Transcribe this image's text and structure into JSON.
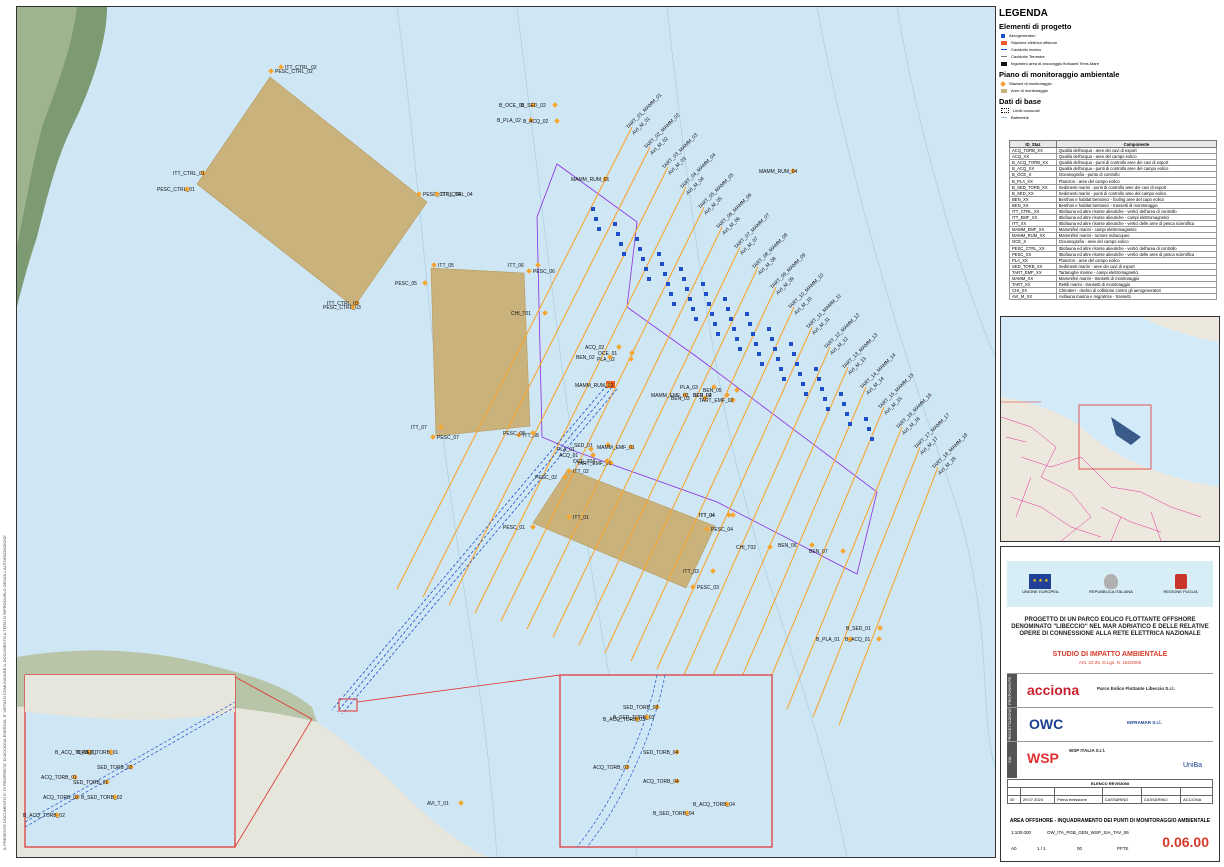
{
  "legend": {
    "title": "LEGENDA",
    "sections": [
      {
        "title": "Elementi di progetto",
        "items": [
          {
            "label": "Aerogeneratori",
            "color": "#1f4fc8",
            "kind": "square"
          },
          {
            "label": "Stazione elettrica offshore",
            "color": "#f15a22",
            "kind": "rect"
          },
          {
            "label": "Cavidotto marino",
            "color": "#1f4fc8",
            "kind": "dash"
          },
          {
            "label": "Cavidotto Terrestre",
            "color": "#7a7a7a",
            "kind": "dash"
          },
          {
            "label": "Ingombro area di ancoraggio fluttuanti Terra-Mare",
            "color": "#111111",
            "kind": "rect"
          }
        ]
      },
      {
        "title": "Piano di monitoraggio ambientale",
        "items": [
          {
            "label": "Stazioni di monitoraggio",
            "color": "#f0a030",
            "kind": "diamond"
          },
          {
            "label": "Aree di monitoraggio",
            "color": "#c9b27c",
            "kind": "rect"
          }
        ]
      },
      {
        "title": "Dati di base",
        "items": [
          {
            "label": "Limiti comunali",
            "color": "#111111",
            "kind": "dots"
          },
          {
            "label": "Batimetrie",
            "color": "#9fc4dd",
            "kind": "line"
          }
        ]
      }
    ]
  },
  "component_table": {
    "headers": [
      "ID_Staz",
      "Componente"
    ],
    "rows": [
      [
        "ACQ_TORB_XX",
        "Qualità dell'acqua - aree dei cavi di export"
      ],
      [
        "ACQ_XX",
        "Qualità dell'acqua - aree del campo eolico"
      ],
      [
        "B_ACQ_TORB_XX",
        "Qualità dell'acqua - punti di controllo aree dei cavi di export"
      ],
      [
        "B_ACQ_XX",
        "Qualità dell'acqua - punti di controllo aree del campo eolico"
      ],
      [
        "B_OCE_X",
        "Oceanografia - punto di controllo"
      ],
      [
        "B_PLA_XX",
        "Plancton - aree del campo eolico"
      ],
      [
        "B_SED_TORB_XX",
        "Sedimenti marini - punti di controllo aree dei cavi di export"
      ],
      [
        "B_SED_XX",
        "Sedimenti marini - punti di controllo aree del campo eolico"
      ],
      [
        "BEN_XX",
        "Benthos e habitat bentonici - fouling aree del capo eolico"
      ],
      [
        "BEN_XX",
        "Benthos e habitat bentonici - transetti di monitoraggio"
      ],
      [
        "ITT_CTRL_XX",
        "Ittiofauna ed altre risorse alieutiche - vertici dell'area di controllo"
      ],
      [
        "ITT_EMF_XX",
        "Ittiofauna ed altre risorse alieutiche - campi elettromagnetici"
      ],
      [
        "ITT_XX",
        "Ittiofauna ed altre risorse alieutiche - vertici delle aree di pesca scientifica"
      ],
      [
        "MAMM_EMF_XX",
        "Mammiferi marini - campi elettromagnetici"
      ],
      [
        "MAMM_RUM_XX",
        "Mammiferi marini - rumore subacqueo"
      ],
      [
        "OCE_X",
        "Oceanografia - aree del campo eolico"
      ],
      [
        "PESC_CTRL_XX",
        "Ittiofauna ed altre risorse alieutiche - vertici dell'area di controllo"
      ],
      [
        "PESC_XX",
        "Ittiofauna ed altre risorse alieutiche - vertici delle aree di pesca scientifica"
      ],
      [
        "PLA_XX",
        "Plancton - aree del campo eolico"
      ],
      [
        "SED_TORB_XX",
        "Sedimenti marini - aree dei cavi di export"
      ],
      [
        "TART_EMF_XX",
        "Tartarughe marine - campi elettromagnetici"
      ],
      [
        "MAMM_XX",
        "Mammiferi marini - transetti di monitoraggio"
      ],
      [
        "TART_XX",
        "Rettili marini - transetti di monitoraggio"
      ],
      [
        "CHI_XX",
        "Chirotteri - rischio di collisione contro gli aerogeneratori"
      ],
      [
        "AVI_M_XX",
        "Avifauna marina e migratrice - transetti"
      ]
    ]
  },
  "map": {
    "areas": [
      {
        "name": "PESC_CTRL",
        "color": "#c9b27c",
        "labels": [
          "PESC_CTRL_02",
          "PESC_CTRL_01",
          "PESC_CTRL_04",
          "PESC_CTRL_03",
          "ITT_CTRL_02",
          "ITT_CTRL_01",
          "ITT_CTRL_04",
          "ITT_CTRL_03"
        ]
      },
      {
        "name": "PESC_W",
        "labels": [
          "ITT_05",
          "PESC_05",
          "PESC_06",
          "ITT_06",
          "PESC_07",
          "ITT_07",
          "ITT_08",
          "PESC_08"
        ]
      },
      {
        "name": "PESC_S",
        "labels": [
          "ITT_01",
          "PESC_01",
          "ITT_02",
          "PESC_02",
          "PESC_04",
          "ITT_04",
          "PESC_03",
          "ITT_03"
        ]
      }
    ],
    "stations": [
      "B_OCE_01",
      "B_SED_02",
      "B_PLA_02",
      "B_ACQ_02",
      "MAMM_RUM_04",
      "MAMM_RUM_01",
      "MAMM_RUM_02",
      "CHI_T01",
      "ACQ_02",
      "OCE_01",
      "PLA_02",
      "BEN_02",
      "SED_02",
      "PLA_03",
      "BEN_03",
      "TART_EMF_02",
      "MAMM_EMF_02",
      "SED_01",
      "PLA_01",
      "ACQ_01",
      "MAMM_EMF_01",
      "TART_EMF_01",
      "OCE_T03",
      "CHI_T02",
      "BEN_06",
      "BEN_07",
      "ITT_04",
      "B_SED_01",
      "B_PLA_01",
      "B_ACQ_01",
      "AVI_T_01",
      "B_ACQ_TORB_01",
      "B_SED_TORB_01",
      "SED_TORB_02",
      "ACQ_TORB_01",
      "SED_TORB_01",
      "ACQ_TORB_02",
      "B_SED_TORB_02",
      "SED_TORB_03",
      "B_ACQ_TORB_02",
      "ACQ_TORB_03",
      "SED_TORB_04",
      "B_ACQ_TORB_03",
      "B_SED_TORB_03",
      "ACQ_TORB_04",
      "B_SED_TORB_04",
      "B_ACQ_TORB_04",
      "BEN_04",
      "BEN_05"
    ],
    "transects": [
      "TART_01_MAMM_01",
      "AVI_M_01",
      "TART_02_MAMM_02",
      "AVI_M_02",
      "TART_03_MAMM_03",
      "AVI_M_03",
      "TART_04_MAMM_04",
      "AVI_M_04",
      "TART_05_MAMM_05",
      "AVI_M_05",
      "TART_06_MAMM_06",
      "AVI_M_06",
      "TART_07_MAMM_07",
      "AVI_M_07",
      "TART_08_MAMM_08",
      "AVI_M_08",
      "TART_09_MAMM_09",
      "AVI_M_09",
      "TART_10_MAMM_10",
      "AVI_M_10",
      "TART_11_MAMM_11",
      "AVI_M_11",
      "TART_12_MAMM_12",
      "AVI_M_12",
      "TART_13_MAMM_13",
      "AVI_M_13",
      "TART_14_MAMM_14",
      "AVI_M_14",
      "TART_15_MAMM_15",
      "AVI_M_15",
      "TART_16_MAMM_16",
      "AVI_M_16",
      "TART_17_MAMM_17",
      "AVI_M_17",
      "TART_18_MAMM_18",
      "AVI_M_18"
    ],
    "colors": {
      "sea": "#cfe7f5",
      "land": "#e6e6dc",
      "hill": "#7e9a73",
      "area": "#c9b27c",
      "transect": "#f7a531",
      "turbine": "#1f4fc8",
      "boundary": "#8a2be2",
      "zoom": "#e03030"
    }
  },
  "titleblock": {
    "logo_labels": [
      "UNIONE EUROPEA",
      "REPUBBLICA ITALIANA",
      "REGIONE PUGLIA"
    ],
    "project": "PROGETTO DI UN PARCO EOLICO FLOTTANTE OFFSHORE DENOMINATO \"LIBECCIO\" NEL MAR ADRIATICO E DELLE RELATIVE OPERE DI CONNESSIONE ALLA RETE ELETTRICA NAZIONALE",
    "study": "STUDIO DI IMPATTO AMBIENTALE",
    "study_ref": "Artt. 22-25, D.Lgs. N. 152/2006",
    "proponent_side": "PROPONENTE",
    "proponent": "acciona",
    "proponent_company": "Parco Eolico Flottante Libeccio S.r.l.",
    "designer_side": "PROGETTAZIONE",
    "designer": "OWC",
    "designer_company2": "INFRAMAR S.r.l.",
    "study_side": "SIA",
    "wsp": "WSP",
    "wsp_company": "WSP ITALIA S.r.l.",
    "uniba": "UniBa",
    "rev_header": "ELENCO REVISIONI",
    "rev_row": [
      "00",
      "29.07.2024",
      "Prima emissione",
      "CASSARINO",
      "CASSARINO",
      "ACCIONA"
    ],
    "drawing_title": "AREA OFFSHORE - INQUADRAMENTO DEI PUNTI DI MONITORAGGIO AMBIENTALE",
    "scale": "1:100.000",
    "code": "OW_ITA_PGB_GEN_WSP_SIA_TAV_06",
    "format": "A0",
    "sheet_label": "1 / 1",
    "rev": "00",
    "fase": "PFTE",
    "sheet_number": "0.06.00"
  },
  "margin_text": "IL PRESENTE DOCUMENTO E' DI PROPRIETA' DI ACCIONA ENERGIA. E' VIETATO COMUNICARE IL DOCUMENTO A TERZI O RIPRODURLO SENZA L'AUTORIZZAZIONE"
}
